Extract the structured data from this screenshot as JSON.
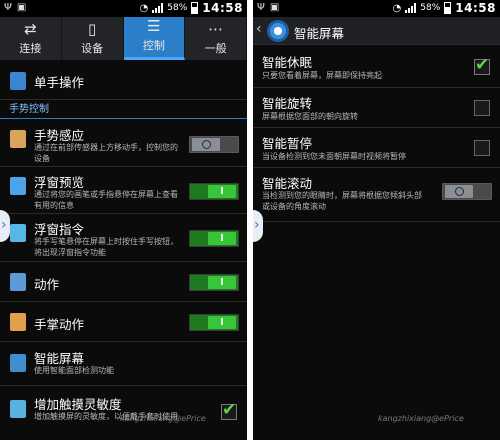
{
  "left": {
    "status": {
      "time": "14:58",
      "battery": "58%"
    },
    "tabs": [
      {
        "label": "连接",
        "icon": "swap-icon"
      },
      {
        "label": "设备",
        "icon": "phone-icon"
      },
      {
        "label": "控制",
        "icon": "sliders-icon",
        "active": true
      },
      {
        "label": "一般",
        "icon": "more-icon"
      }
    ],
    "one_hand": {
      "title": "单手操作"
    },
    "section_gesture": "手势控制",
    "items": [
      {
        "title": "手势感应",
        "sub": "通过在前部传感器上方移动手，控制您的设备",
        "state": "off"
      },
      {
        "title": "浮窗预览",
        "sub": "通过将您的画笔或手指悬停在屏幕上查看有用的信息",
        "state": "on"
      },
      {
        "title": "浮窗指令",
        "sub": "将手写笔悬停在屏幕上时按住手写按钮，将出现浮窗指令功能",
        "state": "on"
      },
      {
        "title": "动作",
        "sub": "",
        "state": "on"
      },
      {
        "title": "手掌动作",
        "sub": "",
        "state": "on"
      },
      {
        "title": "智能屏幕",
        "sub": "使用智能面部检测功能",
        "state": "none"
      },
      {
        "title": "增加触摸灵敏度",
        "sub": "增加触摸屏的灵敏度，以便戴手套时使用",
        "state": "checked"
      }
    ],
    "toggle_on_label": "I",
    "watermark": "kangzhixiang@ePrice"
  },
  "right": {
    "status": {
      "time": "14:58",
      "battery": "58%"
    },
    "header_title": "智能屏幕",
    "items": [
      {
        "title": "智能休眠",
        "sub": "只要您看着屏幕，屏幕即保持亮起",
        "state": "checked"
      },
      {
        "title": "智能旋转",
        "sub": "屏幕根据您面部的朝向旋转",
        "state": "unchecked"
      },
      {
        "title": "智能暂停",
        "sub": "当设备检测到您未面朝屏幕时视频将暂停",
        "state": "unchecked"
      },
      {
        "title": "智能滚动",
        "sub": "当检测到您的眼睛时，屏幕将根据您倾斜头部或设备的角度滚动",
        "state": "off"
      }
    ],
    "watermark": "kangzhixiang@ePrice"
  },
  "colors": {
    "accent": "#2b7fc9",
    "toggle_on": "#38c53a",
    "check": "#5fd34a",
    "section_text": "#7fc4ff"
  }
}
